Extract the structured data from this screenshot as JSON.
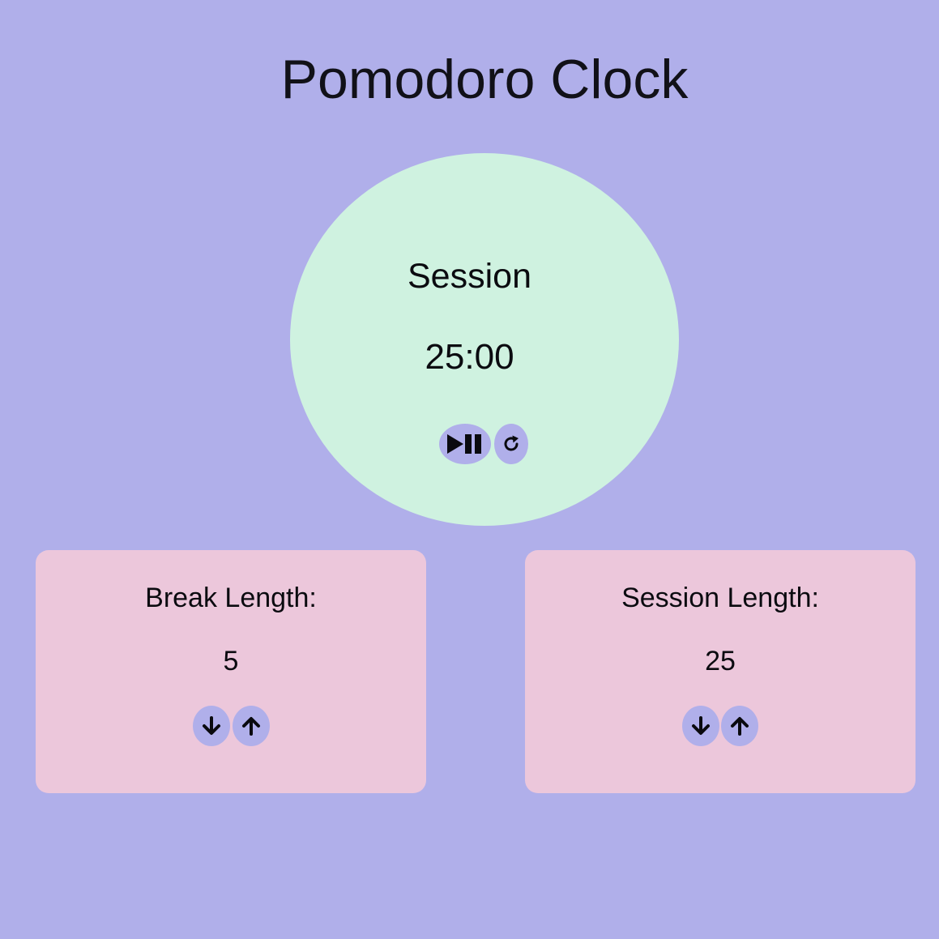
{
  "title": "Pomodoro Clock",
  "timer": {
    "label": "Session",
    "time_left": "25:00",
    "controls": {
      "start_stop_icon": "play-pause-icon",
      "reset_icon": "refresh-icon"
    }
  },
  "break_length": {
    "label": "Break Length:",
    "value": "5",
    "decrement_icon": "arrow-down-icon",
    "increment_icon": "arrow-up-icon"
  },
  "session_length": {
    "label": "Session Length:",
    "value": "25",
    "decrement_icon": "arrow-down-icon",
    "increment_icon": "arrow-up-icon"
  },
  "colors": {
    "background": "#b0afea",
    "clock_face": "#cff2e0",
    "card": "#ecc7db",
    "button": "#b0afea",
    "text": "#0b0b10"
  }
}
